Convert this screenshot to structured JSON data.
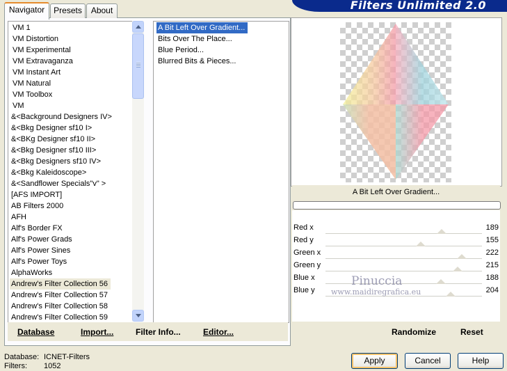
{
  "tabs": [
    "Navigator",
    "Presets",
    "About"
  ],
  "banner_title": "Filters Unlimited 2.0",
  "categories": [
    "VM 1",
    "VM Distortion",
    "VM Experimental",
    "VM Extravaganza",
    "VM Instant Art",
    "VM Natural",
    "VM Toolbox",
    "VM",
    "&<Background Designers IV>",
    "&<Bkg Designer sf10 I>",
    "&<BKg Designer sf10 II>",
    "&<Bkg Designer sf10 III>",
    "&<Bkg Designers sf10 IV>",
    "&<Bkg Kaleidoscope>",
    "&<Sandflower Specials\"v\" >",
    "[AFS IMPORT]",
    "AB Filters 2000",
    "AFH",
    "Alf's Border FX",
    "Alf's Power Grads",
    "Alf's Power Sines",
    "Alf's Power Toys",
    "AlphaWorks",
    "Andrew's Filter Collection 56",
    "Andrew's Filter Collection 57",
    "Andrew's Filter Collection 58",
    "Andrew's Filter Collection 59"
  ],
  "selected_category": "Andrew's Filter Collection 56",
  "filters": [
    "A Bit Left Over Gradient...",
    "Bits Over The Place...",
    "Blue Period...",
    "Blurred Bits & Pieces..."
  ],
  "selected_filter": "A Bit Left Over Gradient...",
  "toolbar": {
    "database": "Database",
    "import": "Import...",
    "filter_info": "Filter Info...",
    "editor": "Editor..."
  },
  "preview_filter_name": "A Bit Left Over Gradient...",
  "params": [
    {
      "label": "Red x",
      "value": 189
    },
    {
      "label": "Red y",
      "value": 155
    },
    {
      "label": "Green x",
      "value": 222
    },
    {
      "label": "Green y",
      "value": 215
    },
    {
      "label": "Blue x",
      "value": 188
    },
    {
      "label": "Blue y",
      "value": 204
    }
  ],
  "watermark": "Pinuccia",
  "watermark_url": "www.maidiregrafica.eu",
  "right_toolbar": {
    "randomize": "Randomize",
    "reset": "Reset"
  },
  "status": {
    "database_label": "Database:",
    "database_value": "ICNET-Filters",
    "filters_label": "Filters:",
    "filters_value": "1052"
  },
  "buttons": {
    "apply": "Apply",
    "cancel": "Cancel",
    "help": "Help"
  },
  "colors": {
    "banner": "#0a2a8c",
    "selection": "#316ac5",
    "tab_accent": "#e68b2c"
  }
}
